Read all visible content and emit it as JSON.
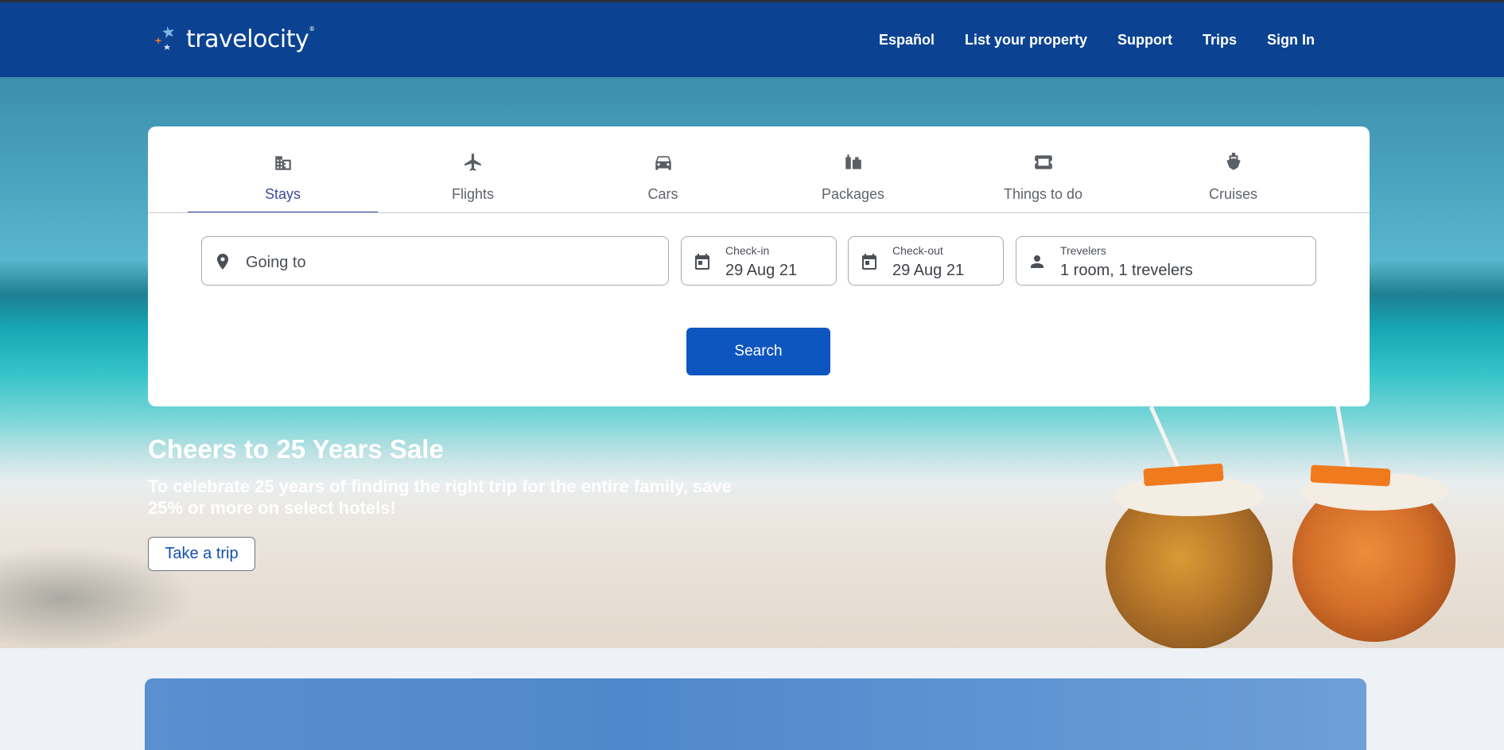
{
  "brand": {
    "name": "travelocity",
    "mark": "®"
  },
  "nav": [
    {
      "label": "Español"
    },
    {
      "label": "List your property"
    },
    {
      "label": "Support"
    },
    {
      "label": "Trips"
    },
    {
      "label": "Sign In"
    }
  ],
  "tabs": [
    {
      "label": "Stays",
      "icon": "building-icon",
      "active": true
    },
    {
      "label": "Flights",
      "icon": "plane-icon"
    },
    {
      "label": "Cars",
      "icon": "car-icon"
    },
    {
      "label": "Packages",
      "icon": "luggage-icon"
    },
    {
      "label": "Things to do",
      "icon": "ticket-icon"
    },
    {
      "label": "Cruises",
      "icon": "ship-icon"
    }
  ],
  "search": {
    "going_to_placeholder": "Going to",
    "checkin_label": "Check-in",
    "checkin_value": "29 Aug 21",
    "checkout_label": "Check-out",
    "checkout_value": "29 Aug 21",
    "travelers_label": "Trevelers",
    "travelers_value": "1 room, 1 trevelers",
    "button_label": "Search"
  },
  "promo": {
    "title": "Cheers to 25 Years Sale",
    "subtitle": "To celebrate 25 years of finding the right trip for the entire family, save 25% or more on select hotels!",
    "cta_label": "Take a trip"
  },
  "colors": {
    "header_bg": "#0b4392",
    "accent": "#0e56bf",
    "tab_active": "#3b4a9e"
  }
}
